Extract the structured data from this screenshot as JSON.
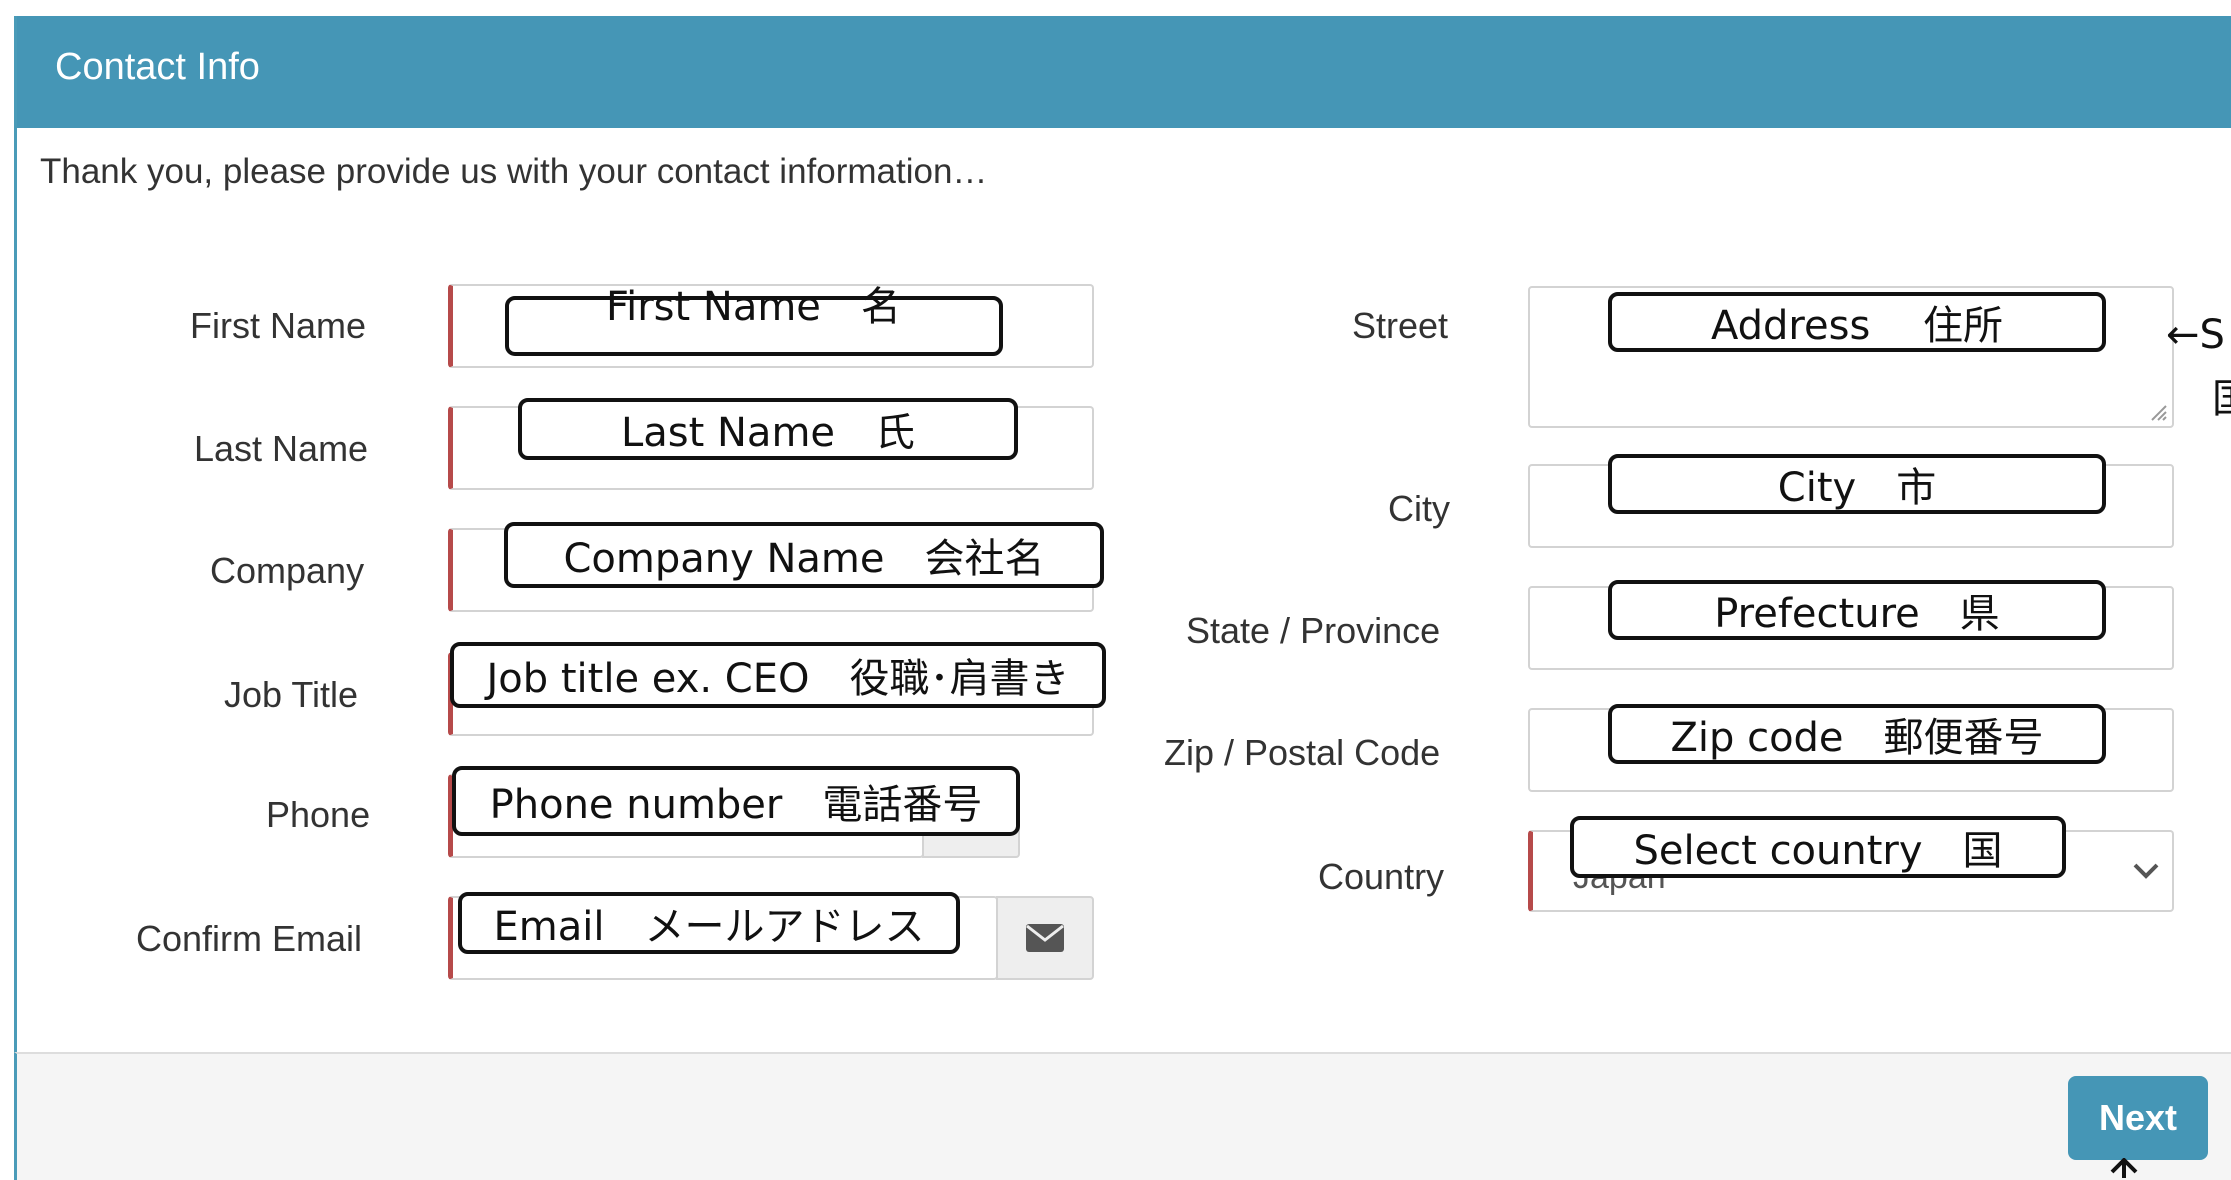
{
  "header": {
    "title": "Contact Info"
  },
  "intro": "Thank you, please provide us with your contact information…",
  "labels": {
    "first_name": "First Name",
    "last_name": "Last Name",
    "company": "Company",
    "job_title": "Job Title",
    "phone": "Phone",
    "confirm_email": "Confirm Email",
    "street": "Street",
    "city": "City",
    "state": "State / Province",
    "zip": "Zip / Postal Code",
    "country": "Country"
  },
  "values": {
    "country_selected": "Japan"
  },
  "annotations": {
    "first_name": "First Name　名",
    "last_name": "Last  Name　氏",
    "company": "Company  Name　会社名",
    "job_title": "Job title ex. CEO　役職･肩書き",
    "phone": "Phone number　電話番号",
    "email": "Email　メールアドレス",
    "street": "Address　 住所",
    "street_side": "←S",
    "street_side2": "国",
    "city": "City　市",
    "state": "Prefecture　県",
    "zip": "Zip code　郵便番号",
    "country": "Select country　国"
  },
  "footer": {
    "next_label": "Next"
  },
  "icons": {
    "email_addon": "envelope-icon",
    "country_select": "chevron-down-icon",
    "next_pointer": "arrow-up-icon"
  },
  "colors": {
    "header_bg": "#4596b6",
    "required_marker": "#b64a4a",
    "button_bg": "#4596b6"
  }
}
